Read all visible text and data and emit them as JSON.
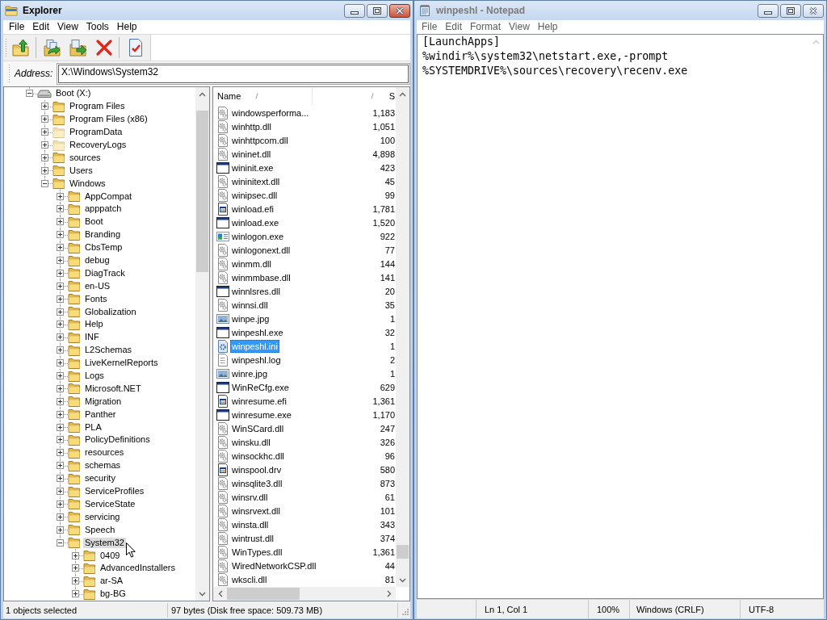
{
  "explorer": {
    "title": "Explorer",
    "active": true,
    "menu": [
      "File",
      "Edit",
      "View",
      "Tools",
      "Help"
    ],
    "address": {
      "label": "Address:",
      "value": "X:\\Windows\\System32"
    },
    "tree": [
      {
        "label": "Boot (X:)",
        "kind": "drive",
        "expanded": true,
        "selected": false,
        "hidden": false,
        "children": [
          {
            "label": "Program Files",
            "kind": "folder",
            "expanded": false,
            "selected": false,
            "hidden": false
          },
          {
            "label": "Program Files (x86)",
            "kind": "folder",
            "expanded": false,
            "selected": false,
            "hidden": false
          },
          {
            "label": "ProgramData",
            "kind": "folder",
            "expanded": false,
            "selected": false,
            "hidden": true
          },
          {
            "label": "RecoveryLogs",
            "kind": "folder",
            "expanded": false,
            "selected": false,
            "hidden": true
          },
          {
            "label": "sources",
            "kind": "folder",
            "expanded": false,
            "selected": false,
            "hidden": false
          },
          {
            "label": "Users",
            "kind": "folder",
            "expanded": false,
            "selected": false,
            "hidden": false
          },
          {
            "label": "Windows",
            "kind": "folder",
            "expanded": true,
            "selected": false,
            "hidden": false,
            "children": [
              {
                "label": "AppCompat",
                "kind": "folder",
                "expanded": false,
                "selected": false,
                "hidden": false
              },
              {
                "label": "apppatch",
                "kind": "folder",
                "expanded": false,
                "selected": false,
                "hidden": false
              },
              {
                "label": "Boot",
                "kind": "folder",
                "expanded": false,
                "selected": false,
                "hidden": false
              },
              {
                "label": "Branding",
                "kind": "folder",
                "expanded": false,
                "selected": false,
                "hidden": false
              },
              {
                "label": "CbsTemp",
                "kind": "folder",
                "expanded": false,
                "selected": false,
                "hidden": false
              },
              {
                "label": "debug",
                "kind": "folder",
                "expanded": false,
                "selected": false,
                "hidden": false
              },
              {
                "label": "DiagTrack",
                "kind": "folder",
                "expanded": false,
                "selected": false,
                "hidden": false
              },
              {
                "label": "en-US",
                "kind": "folder",
                "expanded": false,
                "selected": false,
                "hidden": false
              },
              {
                "label": "Fonts",
                "kind": "folder",
                "expanded": false,
                "selected": false,
                "hidden": false
              },
              {
                "label": "Globalization",
                "kind": "folder",
                "expanded": false,
                "selected": false,
                "hidden": false
              },
              {
                "label": "Help",
                "kind": "folder",
                "expanded": false,
                "selected": false,
                "hidden": false
              },
              {
                "label": "INF",
                "kind": "folder",
                "expanded": false,
                "selected": false,
                "hidden": false
              },
              {
                "label": "L2Schemas",
                "kind": "folder",
                "expanded": false,
                "selected": false,
                "hidden": false
              },
              {
                "label": "LiveKernelReports",
                "kind": "folder",
                "expanded": false,
                "selected": false,
                "hidden": false
              },
              {
                "label": "Logs",
                "kind": "folder",
                "expanded": false,
                "selected": false,
                "hidden": false
              },
              {
                "label": "Microsoft.NET",
                "kind": "folder",
                "expanded": false,
                "selected": false,
                "hidden": false
              },
              {
                "label": "Migration",
                "kind": "folder",
                "expanded": false,
                "selected": false,
                "hidden": false
              },
              {
                "label": "Panther",
                "kind": "folder",
                "expanded": false,
                "selected": false,
                "hidden": false
              },
              {
                "label": "PLA",
                "kind": "folder",
                "expanded": false,
                "selected": false,
                "hidden": false
              },
              {
                "label": "PolicyDefinitions",
                "kind": "folder",
                "expanded": false,
                "selected": false,
                "hidden": false
              },
              {
                "label": "resources",
                "kind": "folder",
                "expanded": false,
                "selected": false,
                "hidden": false
              },
              {
                "label": "schemas",
                "kind": "folder",
                "expanded": false,
                "selected": false,
                "hidden": false
              },
              {
                "label": "security",
                "kind": "folder",
                "expanded": false,
                "selected": false,
                "hidden": false
              },
              {
                "label": "ServiceProfiles",
                "kind": "folder",
                "expanded": false,
                "selected": false,
                "hidden": false
              },
              {
                "label": "ServiceState",
                "kind": "folder",
                "expanded": false,
                "selected": false,
                "hidden": false
              },
              {
                "label": "servicing",
                "kind": "folder",
                "expanded": false,
                "selected": false,
                "hidden": false
              },
              {
                "label": "Speech",
                "kind": "folder",
                "expanded": false,
                "selected": false,
                "hidden": false
              },
              {
                "label": "System32",
                "kind": "folder",
                "expanded": true,
                "selected": true,
                "hidden": false,
                "children": [
                  {
                    "label": "0409",
                    "kind": "folder",
                    "expanded": false,
                    "selected": false,
                    "hidden": false
                  },
                  {
                    "label": "AdvancedInstallers",
                    "kind": "folder",
                    "expanded": false,
                    "selected": false,
                    "hidden": false
                  },
                  {
                    "label": "ar-SA",
                    "kind": "folder",
                    "expanded": false,
                    "selected": false,
                    "hidden": false
                  },
                  {
                    "label": "bg-BG",
                    "kind": "folder",
                    "expanded": false,
                    "selected": false,
                    "hidden": false
                  }
                ]
              }
            ]
          }
        ]
      }
    ],
    "file_list": {
      "columns": [
        "Name",
        "S"
      ],
      "rows": [
        {
          "name": "windowsperforma...",
          "size": "1,183",
          "kind": "library",
          "selected": false
        },
        {
          "name": "winhttp.dll",
          "size": "1,051",
          "kind": "library",
          "selected": false
        },
        {
          "name": "winhttpcom.dll",
          "size": "100",
          "kind": "library",
          "selected": false
        },
        {
          "name": "wininet.dll",
          "size": "4,898",
          "kind": "library",
          "selected": false
        },
        {
          "name": "wininit.exe",
          "size": "423",
          "kind": "program",
          "selected": false
        },
        {
          "name": "wininitext.dll",
          "size": "45",
          "kind": "library",
          "selected": false
        },
        {
          "name": "winipsec.dll",
          "size": "99",
          "kind": "library",
          "selected": false
        },
        {
          "name": "winload.efi",
          "size": "1,781",
          "kind": "firmware",
          "selected": false
        },
        {
          "name": "winload.exe",
          "size": "1,520",
          "kind": "program",
          "selected": false
        },
        {
          "name": "winlogon.exe",
          "size": "922",
          "kind": "app",
          "selected": false
        },
        {
          "name": "winlogonext.dll",
          "size": "77",
          "kind": "library",
          "selected": false
        },
        {
          "name": "winmm.dll",
          "size": "144",
          "kind": "library",
          "selected": false
        },
        {
          "name": "winmmbase.dll",
          "size": "141",
          "kind": "library",
          "selected": false
        },
        {
          "name": "winnlsres.dll",
          "size": "20",
          "kind": "program",
          "selected": false
        },
        {
          "name": "winnsi.dll",
          "size": "35",
          "kind": "library",
          "selected": false
        },
        {
          "name": "winpe.jpg",
          "size": "1",
          "kind": "image",
          "selected": false
        },
        {
          "name": "winpeshl.exe",
          "size": "32",
          "kind": "program",
          "selected": false
        },
        {
          "name": "winpeshl.ini",
          "size": "1",
          "kind": "settings",
          "selected": true
        },
        {
          "name": "winpeshl.log",
          "size": "2",
          "kind": "text",
          "selected": false
        },
        {
          "name": "winre.jpg",
          "size": "1",
          "kind": "image",
          "selected": false
        },
        {
          "name": "WinReCfg.exe",
          "size": "629",
          "kind": "program",
          "selected": false
        },
        {
          "name": "winresume.efi",
          "size": "1,361",
          "kind": "firmware",
          "selected": false
        },
        {
          "name": "winresume.exe",
          "size": "1,170",
          "kind": "program",
          "selected": false
        },
        {
          "name": "WinSCard.dll",
          "size": "247",
          "kind": "library",
          "selected": false
        },
        {
          "name": "winsku.dll",
          "size": "326",
          "kind": "library",
          "selected": false
        },
        {
          "name": "winsockhc.dll",
          "size": "96",
          "kind": "library",
          "selected": false
        },
        {
          "name": "winspool.drv",
          "size": "580",
          "kind": "firmware",
          "selected": false
        },
        {
          "name": "winsqlite3.dll",
          "size": "873",
          "kind": "library",
          "selected": false
        },
        {
          "name": "winsrv.dll",
          "size": "61",
          "kind": "library",
          "selected": false
        },
        {
          "name": "winsrvext.dll",
          "size": "101",
          "kind": "library",
          "selected": false
        },
        {
          "name": "winsta.dll",
          "size": "343",
          "kind": "library",
          "selected": false
        },
        {
          "name": "wintrust.dll",
          "size": "374",
          "kind": "library",
          "selected": false
        },
        {
          "name": "WinTypes.dll",
          "size": "1,361",
          "kind": "library",
          "selected": false
        },
        {
          "name": "WiredNetworkCSP.dll",
          "size": "44",
          "kind": "library",
          "selected": false
        },
        {
          "name": "wkscli.dll",
          "size": "81",
          "kind": "library",
          "selected": false
        }
      ]
    },
    "status_bar": [
      "1 objects selected",
      "97 bytes (Disk free space: 509.73 MB)"
    ]
  },
  "notepad": {
    "title": "winpeshl - Notepad",
    "active": false,
    "menu": [
      "File",
      "Edit",
      "Format",
      "View",
      "Help"
    ],
    "text": [
      "[LaunchApps]",
      "%windir%\\system32\\netstart.exe,-prompt",
      "%SYSTEMDRIVE%\\sources\\recovery\\recenv.exe"
    ],
    "status_bar": [
      "Ln 1, Col 1",
      "100%",
      "Windows (CRLF)",
      "UTF-8"
    ]
  }
}
